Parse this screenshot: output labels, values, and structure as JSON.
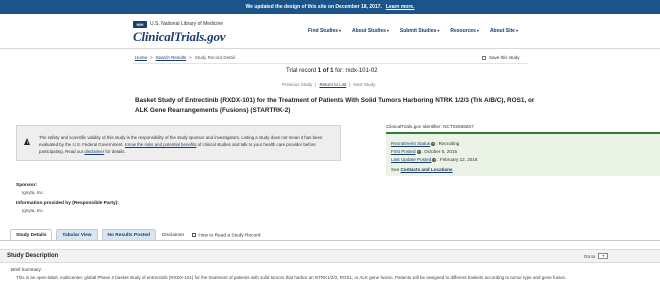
{
  "banner": {
    "message": "We updated the design of this site on December 18, 2017.",
    "link": "Learn more."
  },
  "header": {
    "nlm_logo": "NIH",
    "nlm_text": "U.S. National Library of Medicine",
    "site_logo": "ClinicalTrials.gov",
    "nav": [
      {
        "label": "Find Studies"
      },
      {
        "label": "About Studies"
      },
      {
        "label": "Submit Studies"
      },
      {
        "label": "Resources"
      },
      {
        "label": "About Site"
      }
    ],
    "chevron": "▾"
  },
  "breadcrumb": {
    "home": "Home",
    "sep": ">",
    "search_results": "Search Results",
    "current": "Study Record Detail"
  },
  "save_study": "Save this study",
  "record": {
    "prefix": "Trial record",
    "num": "1 of 1",
    "for_label": "for:",
    "query": "rxdx-101-02"
  },
  "record_nav": {
    "previous": "Previous Study",
    "return": "Return to List",
    "next": "Next Study",
    "sep": "|"
  },
  "study_title": "Basket Study of Entrectinib (RXDX-101) for the Treatment of Patients With Solid Tumors Harboring NTRK 1/2/3 (Trk A/B/C), ROS1, or ALK Gene Rearrangements (Fusions) (STARTRK-2)",
  "disclaimer": {
    "icon": "warning-icon",
    "text_1": "The safety and scientific validity of this study is the responsibility of the study sponsor and investigators. Listing a study does not mean it has been evaluated by the U.S. Federal Government.",
    "link_1": "Know the risks and potential benefits",
    "text_2": "of clinical studies and talk to your health care provider before participating. Read our",
    "link_2": "disclaimer",
    "text_3": "for details."
  },
  "identifier": "ClinicalTrials.gov Identifier: NCT02568267",
  "status": {
    "recruitment_label": "Recruitment Status",
    "recruitment_value": ": Recruiting",
    "first_posted_label": "First Posted",
    "first_posted_value": ": October 6, 2015",
    "last_update_label": "Last Update Posted",
    "last_update_value": ": February 12, 2018",
    "see": "See",
    "contacts_link": "Contacts and Locations",
    "q": "?"
  },
  "sponsor": {
    "label": "Sponsor:",
    "value": "Ignyta, Inc."
  },
  "info_provided": {
    "label": "Information provided by (Responsible Party):",
    "value": "Ignyta, Inc."
  },
  "tabs": [
    {
      "label": "Study Details"
    },
    {
      "label": "Tabular View"
    },
    {
      "label": "No Results Posted"
    },
    {
      "label": "Disclaimer"
    },
    {
      "label": "How to Read a Study Record"
    }
  ],
  "study_description": {
    "title": "Study Description",
    "goto": "Go to",
    "goto_chevron": "▾",
    "brief_label": "Brief Summary:",
    "brief_text": "This is an open-label, multicenter, global Phase 2 basket study of entrectinib (RXDX-101) for the treatment of patients with solid tumors that harbor an NTRK1/2/3, ROS1, or ALK gene fusion. Patients will be assigned to different baskets according to tumor type and gene fusion."
  }
}
